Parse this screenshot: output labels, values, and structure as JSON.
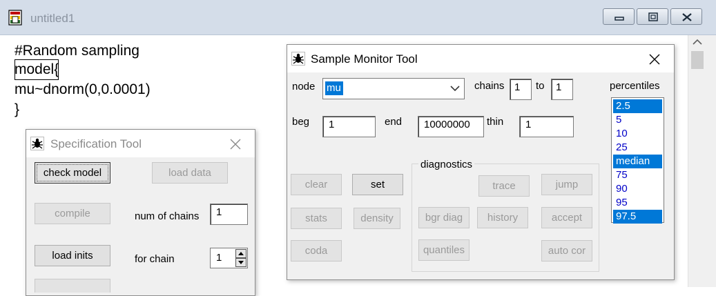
{
  "main_window": {
    "title": "untitled1",
    "code_lines": [
      "#Random sampling",
      "model{",
      "mu~dnorm(0,0.0001)",
      "}"
    ]
  },
  "specification_tool": {
    "title": "Specification Tool",
    "buttons": {
      "check_model": "check model",
      "load_data": "load data",
      "compile": "compile",
      "load_inits": "load inits"
    },
    "num_of_chains_label": "num of chains",
    "num_of_chains_value": "1",
    "for_chain_label": "for chain",
    "for_chain_value": "1"
  },
  "sample_monitor_tool": {
    "title": "Sample Monitor Tool",
    "node_label": "node",
    "node_value": "mu",
    "chains_label": "chains",
    "chains_from": "1",
    "to_label": "to",
    "chains_to": "1",
    "beg_label": "beg",
    "beg_value": "1",
    "end_label": "end",
    "end_value": "10000000",
    "thin_label": "thin",
    "thin_value": "1",
    "percentiles_label": "percentiles",
    "percentiles": [
      {
        "label": "2.5",
        "selected": true
      },
      {
        "label": "5",
        "selected": false
      },
      {
        "label": "10",
        "selected": false
      },
      {
        "label": "25",
        "selected": false
      },
      {
        "label": "median",
        "selected": true
      },
      {
        "label": "75",
        "selected": false
      },
      {
        "label": "90",
        "selected": false
      },
      {
        "label": "95",
        "selected": false
      },
      {
        "label": "97.5",
        "selected": true
      }
    ],
    "diagnostics_label": "diagnostics",
    "buttons": {
      "clear": "clear",
      "set": "set",
      "stats": "stats",
      "density": "density",
      "coda": "coda",
      "trace": "trace",
      "jump": "jump",
      "bgr_diag": "bgr diag",
      "history": "history",
      "accept": "accept",
      "quantiles": "quantiles",
      "auto_cor": "auto cor"
    }
  }
}
